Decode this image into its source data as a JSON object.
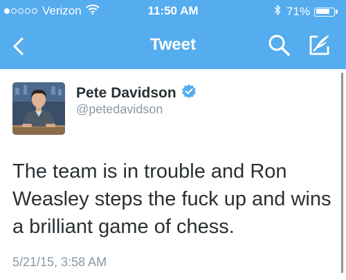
{
  "status_bar": {
    "carrier": "Verizon",
    "time": "11:50 AM",
    "battery_percent": "71%",
    "signal_bars_filled": 1,
    "signal_bars_total": 5,
    "battery_level": 0.71
  },
  "nav": {
    "title": "Tweet",
    "back_icon": "chevron-left-icon",
    "search_icon": "search-icon",
    "compose_icon": "compose-icon"
  },
  "tweet": {
    "author_name": "Pete Davidson",
    "author_handle": "@petedavidson",
    "verified": true,
    "text": "The team is in trouble and Ron Weasley steps the fuck up and wins a brilliant game of chess.",
    "timestamp": "5/21/15, 3:58 AM"
  },
  "colors": {
    "header_bg": "#55acee",
    "verified_badge": "#55acee",
    "text_primary": "#292f33",
    "text_secondary": "#8899a6"
  }
}
